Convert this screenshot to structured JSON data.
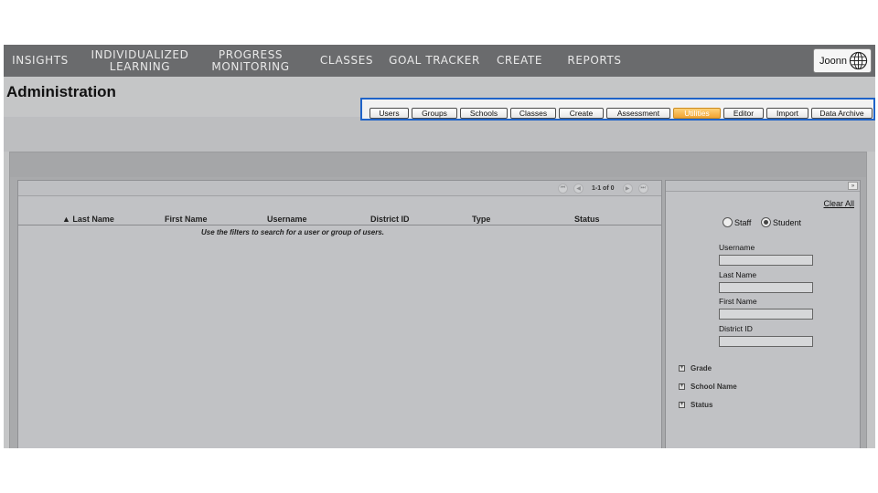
{
  "nav": {
    "items": [
      {
        "line1": "INSIGHTS",
        "line2": ""
      },
      {
        "line1": "INDIVIDUALIZED",
        "line2": "LEARNING"
      },
      {
        "line1": "PROGRESS",
        "line2": "MONITORING"
      },
      {
        "line1": "CLASSES",
        "line2": ""
      },
      {
        "line1": "GOAL TRACKER",
        "line2": ""
      },
      {
        "line1": "CREATE",
        "line2": ""
      },
      {
        "line1": "REPORTS",
        "line2": ""
      }
    ],
    "user_name": "Joonn"
  },
  "page": {
    "title": "Administration"
  },
  "tabs": [
    {
      "label": "Users",
      "active": false
    },
    {
      "label": "Groups",
      "active": false
    },
    {
      "label": "Schools",
      "active": false
    },
    {
      "label": "Classes",
      "active": false
    },
    {
      "label": "Create",
      "active": false
    },
    {
      "label": "Assessment",
      "active": false
    },
    {
      "label": "Utilities",
      "active": true
    },
    {
      "label": "Editor",
      "active": false
    },
    {
      "label": "Import",
      "active": false
    },
    {
      "label": "Data Archive",
      "active": false
    }
  ],
  "results": {
    "pager_text": "1-1 of 0",
    "columns": [
      {
        "label": "▲ Last Name"
      },
      {
        "label": "First Name"
      },
      {
        "label": "Username"
      },
      {
        "label": "District ID"
      },
      {
        "label": "Type"
      },
      {
        "label": "Status"
      }
    ],
    "empty_message": "Use the filters to search for a user or group of users."
  },
  "filters": {
    "clear_all": "Clear All",
    "radio_staff": "Staff",
    "radio_student": "Student",
    "selected": "Student",
    "fields": [
      {
        "label": "Username",
        "value": ""
      },
      {
        "label": "Last Name",
        "value": ""
      },
      {
        "label": "First Name",
        "value": ""
      },
      {
        "label": "District ID",
        "value": ""
      }
    ],
    "expanders": [
      {
        "label": "Grade"
      },
      {
        "label": "School Name"
      },
      {
        "label": "Status"
      }
    ]
  },
  "colors": {
    "nav_bg": "#6a6b6d",
    "tab_active": "#f0a331",
    "highlight_border": "#1f63c8"
  }
}
